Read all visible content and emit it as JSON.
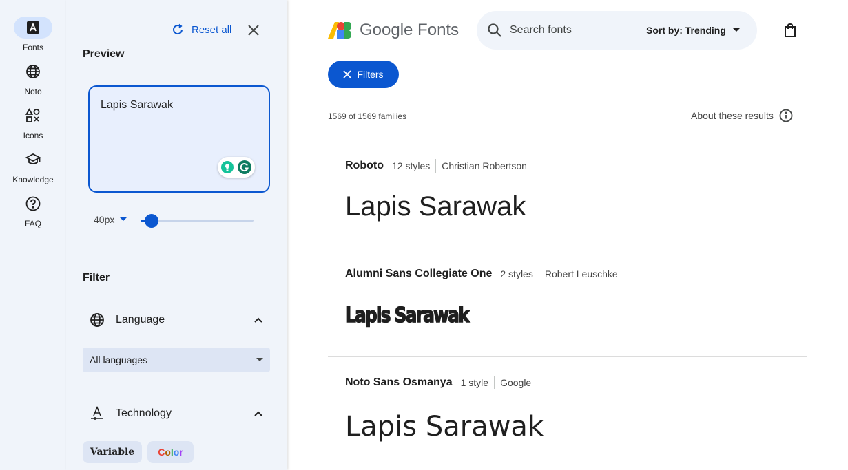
{
  "rail": {
    "items": [
      {
        "label": "Fonts",
        "icon": "fonts-icon",
        "active": true
      },
      {
        "label": "Noto",
        "icon": "globe-icon"
      },
      {
        "label": "Icons",
        "icon": "shapes-icon"
      },
      {
        "label": "Knowledge",
        "icon": "school-icon"
      },
      {
        "label": "FAQ",
        "icon": "help-icon"
      }
    ]
  },
  "panel": {
    "reset_label": "Reset all",
    "preview_heading": "Preview",
    "preview_text": "Lapis Sarawak",
    "size_value": "40px",
    "size_fraction": 0.1,
    "filter_heading": "Filter",
    "language_label": "Language",
    "language_value": "All languages",
    "technology_label": "Technology",
    "chip_variable": "Variable",
    "chip_color": "Color"
  },
  "header": {
    "logo_text": "Google Fonts",
    "search_placeholder": "Search fonts",
    "sort_label": "Sort by: Trending",
    "filters_label": "Filters"
  },
  "results": {
    "count": "1569 of 1569 families",
    "about_label": "About these results"
  },
  "fonts": [
    {
      "name": "Roboto",
      "styles": "12 styles",
      "designer": "Christian Robertson",
      "sample": "Lapis Sarawak"
    },
    {
      "name": "Alumni Sans Collegiate One",
      "styles": "2 styles",
      "designer": "Robert Leuschke",
      "sample": "Lapis Sarawak"
    },
    {
      "name": "Noto Sans Osmanya",
      "styles": "1 style",
      "designer": "Google",
      "sample": "Lapis Sarawak"
    }
  ],
  "colors": {
    "accent": "#0b57d0",
    "rail_bg": "#f0f4fa",
    "active_chip": "#d3e3fd"
  }
}
